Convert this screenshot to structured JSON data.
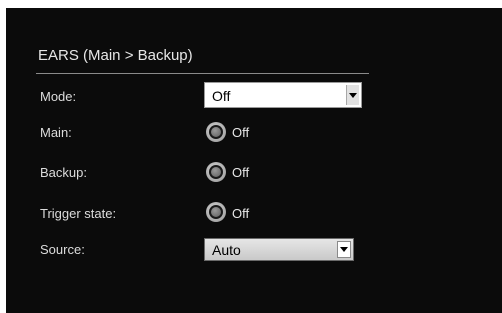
{
  "panel": {
    "title": "EARS (Main > Backup)"
  },
  "fields": {
    "mode": {
      "label": "Mode:",
      "value": "Off"
    },
    "main": {
      "label": "Main:",
      "value": "Off"
    },
    "backup": {
      "label": "Backup:",
      "value": "Off"
    },
    "trigger_state": {
      "label": "Trigger state:",
      "value": "Off"
    },
    "source": {
      "label": "Source:",
      "value": "Auto"
    }
  },
  "icons": {
    "dropdown_arrow": "chevron-down-icon",
    "status_led": "status-indicator-icon"
  },
  "colors": {
    "panel_background": "#0b0b0b",
    "label_text": "#dcdcdc",
    "divider": "#8a8a8a"
  }
}
